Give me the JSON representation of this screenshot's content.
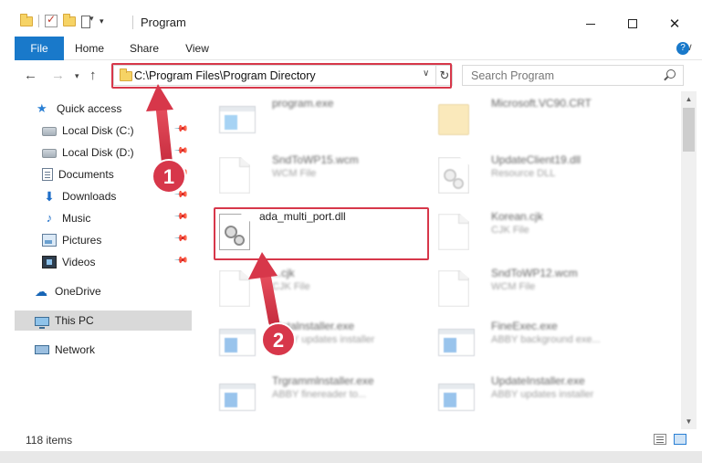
{
  "window": {
    "title": "Program"
  },
  "ribbon": {
    "tabs": [
      {
        "label": "File"
      },
      {
        "label": "Home"
      },
      {
        "label": "Share"
      },
      {
        "label": "View"
      }
    ]
  },
  "address": {
    "path": "C:\\Program Files\\Program Directory"
  },
  "search": {
    "placeholder": "Search Program"
  },
  "sidebar": {
    "items": [
      {
        "label": "Quick access",
        "icon": "star-icon",
        "pinned": false
      },
      {
        "label": "Local Disk (C:)",
        "icon": "disk-icon",
        "pinned": true
      },
      {
        "label": "Local Disk (D:)",
        "icon": "disk-icon",
        "pinned": true
      },
      {
        "label": "Documents",
        "icon": "documents-icon",
        "pinned": true
      },
      {
        "label": "Downloads",
        "icon": "download-icon",
        "pinned": true
      },
      {
        "label": "Music",
        "icon": "music-icon",
        "pinned": true
      },
      {
        "label": "Pictures",
        "icon": "pictures-icon",
        "pinned": true
      },
      {
        "label": "Videos",
        "icon": "videos-icon",
        "pinned": true
      },
      {
        "label": "OneDrive",
        "icon": "cloud-icon",
        "pinned": false
      },
      {
        "label": "This PC",
        "icon": "pc-icon",
        "pinned": false,
        "selected": true
      },
      {
        "label": "Network",
        "icon": "network-icon",
        "pinned": false
      }
    ]
  },
  "files": [
    {
      "name": "program.exe",
      "type": "",
      "icon": "exe-icon"
    },
    {
      "name": "Microsoft.VC90.CRT",
      "type": "",
      "icon": "folder-icon"
    },
    {
      "name": "SndToWP15.wcm",
      "type": "WCM File",
      "icon": "document-icon"
    },
    {
      "name": "UpdateClient19.dll",
      "type": "Resource DLL",
      "icon": "dll-icon"
    },
    {
      "name": "ada_multi_port.dll",
      "type": "",
      "icon": "dll-icon",
      "highlighted": true
    },
    {
      "name": "Korean.cjk",
      "type": "CJK File",
      "icon": "document-icon"
    },
    {
      "name": "...cjk",
      "type": "CJK File",
      "icon": "document-icon"
    },
    {
      "name": "SndToWP12.wcm",
      "type": "WCM File",
      "icon": "document-icon"
    },
    {
      "name": "Metalnstaller.exe",
      "type": "ABBY updates installer",
      "icon": "exe-icon"
    },
    {
      "name": "FineExec.exe",
      "type": "ABBY background exe...",
      "icon": "exe-icon"
    },
    {
      "name": "Trgrammlnstaller.exe",
      "type": "ABBY finereader to...",
      "icon": "exe-icon"
    },
    {
      "name": "UpdateInstaller.exe",
      "type": "ABBY updates installer",
      "icon": "exe-icon"
    }
  ],
  "status": {
    "item_count": "118 items"
  },
  "annotations": [
    {
      "number": "1"
    },
    {
      "number": "2"
    }
  ],
  "colors": {
    "accent": "#1979ca",
    "annotation_red": "#d7374a",
    "selected_bg": "#d9d9d9"
  }
}
